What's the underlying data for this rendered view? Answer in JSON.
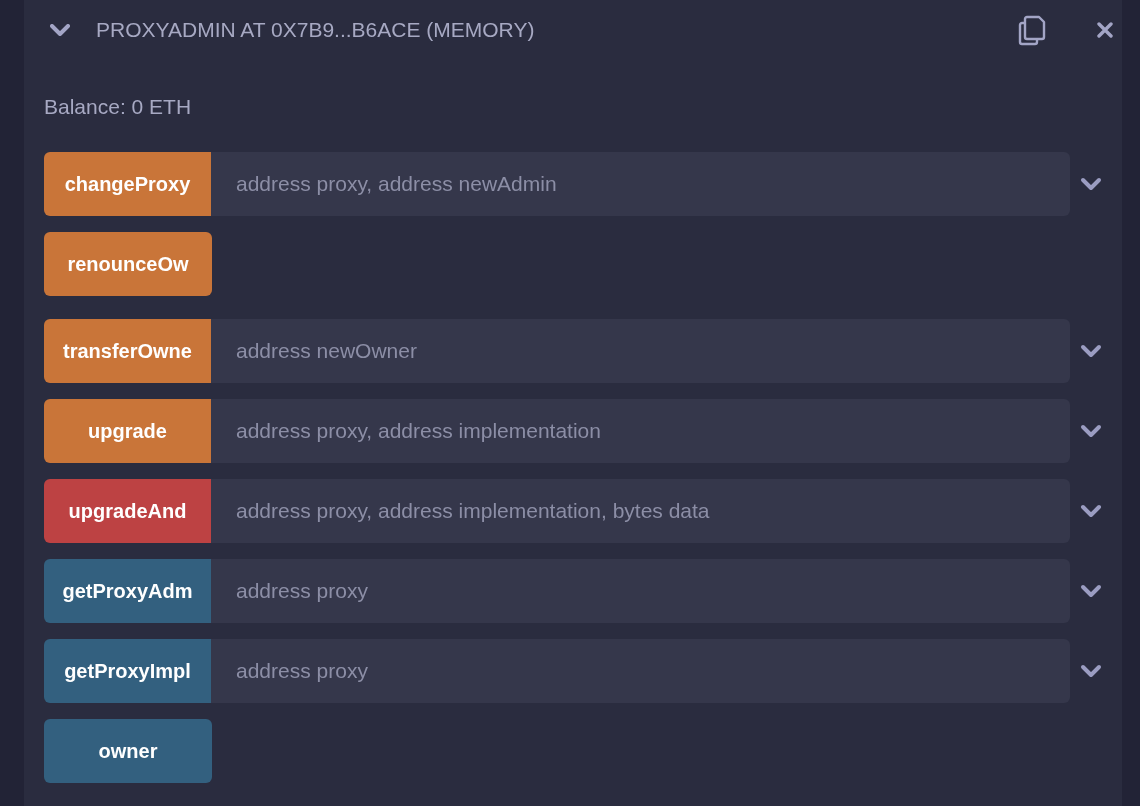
{
  "instance": {
    "title": "PROXYADMIN AT 0X7B9...B6ACE (MEMORY)",
    "expanded": true
  },
  "balance": "Balance: 0 ETH",
  "functions": [
    {
      "name": "changeProxy",
      "kind": "transact",
      "placeholder": "address proxy, address newAdmin"
    },
    {
      "name": "renounceOw",
      "kind": "transact"
    },
    {
      "name": "transferOwne",
      "kind": "transact",
      "placeholder": "address newOwner"
    },
    {
      "name": "upgrade",
      "kind": "transact",
      "placeholder": "address proxy, address implementation"
    },
    {
      "name": "upgradeAnd",
      "kind": "payable",
      "placeholder": "address proxy, address implementation, bytes data"
    },
    {
      "name": "getProxyAdm",
      "kind": "call",
      "placeholder": "address proxy"
    },
    {
      "name": "getProxyImpl",
      "kind": "call",
      "placeholder": "address proxy"
    },
    {
      "name": "owner",
      "kind": "call"
    }
  ]
}
